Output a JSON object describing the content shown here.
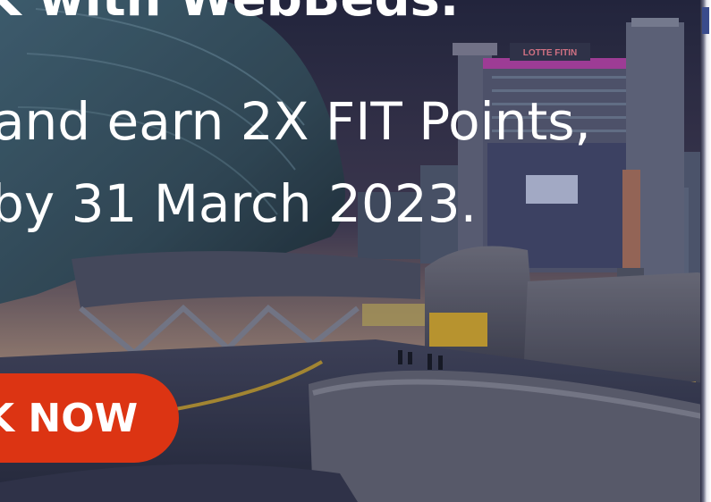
{
  "hero": {
    "headline": "K with WebBeds.",
    "subline_1": "and earn 2X FIT Points,",
    "subline_2": "by 31 March 2023.",
    "cta_label": "K NOW"
  },
  "sign": {
    "text": "LOTTE FITIN"
  },
  "colors": {
    "cta_bg": "#dc3413",
    "text": "#ffffff",
    "sky_top": "#2a2d4a",
    "sky_bottom": "#b89a8a"
  }
}
